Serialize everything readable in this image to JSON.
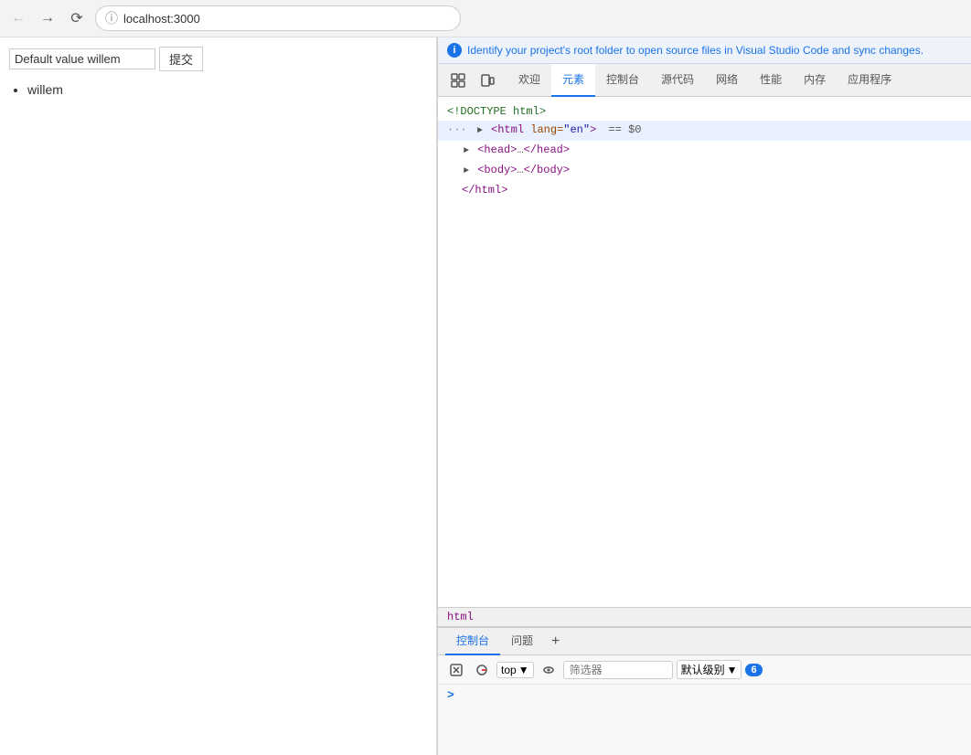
{
  "browser": {
    "url": "localhost:3000"
  },
  "page": {
    "input_value": "Default value willem",
    "submit_label": "提交",
    "list_item": "willem"
  },
  "devtools": {
    "info_message": "Identify your project's root folder to open source files in Visual Studio Code and sync changes.",
    "tabs": [
      "欢迎",
      "元素",
      "控制台",
      "源代码",
      "网络",
      "性能",
      "内存",
      "应用程序"
    ],
    "active_tab": "元素",
    "dom": {
      "doctype": "<!DOCTYPE html>",
      "html_open": "<html lang=\"en\">",
      "equals_marker": "== $0",
      "head": "<head>…</head>",
      "body": "<body>…</body>",
      "html_close": "</html>"
    },
    "breadcrumb": "html",
    "bottom_tabs": [
      "控制台",
      "问题"
    ],
    "active_bottom_tab": "控制台",
    "console": {
      "top_label": "top",
      "filter_placeholder": "筛选器",
      "level_label": "默认级别",
      "badge_count": "6",
      "prompt": ">"
    }
  }
}
